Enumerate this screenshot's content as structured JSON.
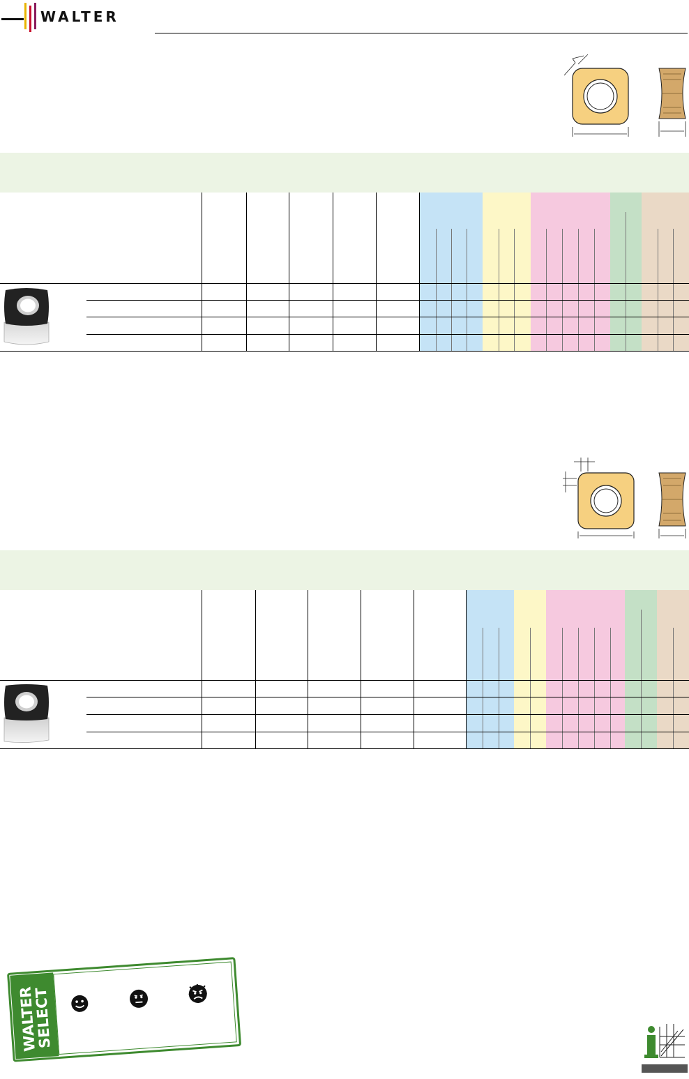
{
  "brand": {
    "logo_text": "WALTER",
    "stripe_colors": [
      "#e8b400",
      "#c8102e",
      "#8a1c5c"
    ]
  },
  "colors": {
    "material_p": "#c5e3f6",
    "material_m": "#fdf7c7",
    "material_k": "#f6c9df",
    "material_n": "#c4e0c6",
    "material_s": "#ead9c6",
    "header_band": "#ecf4e4",
    "insert_gold": "#f6d080"
  },
  "stamp": {
    "label": "WALTER SELECT",
    "color": "#3e8a2f",
    "face_icons": [
      "happy-face-icon",
      "neutral-face-icon",
      "angry-face-icon"
    ]
  },
  "footer": {
    "icon": "info-icon"
  }
}
